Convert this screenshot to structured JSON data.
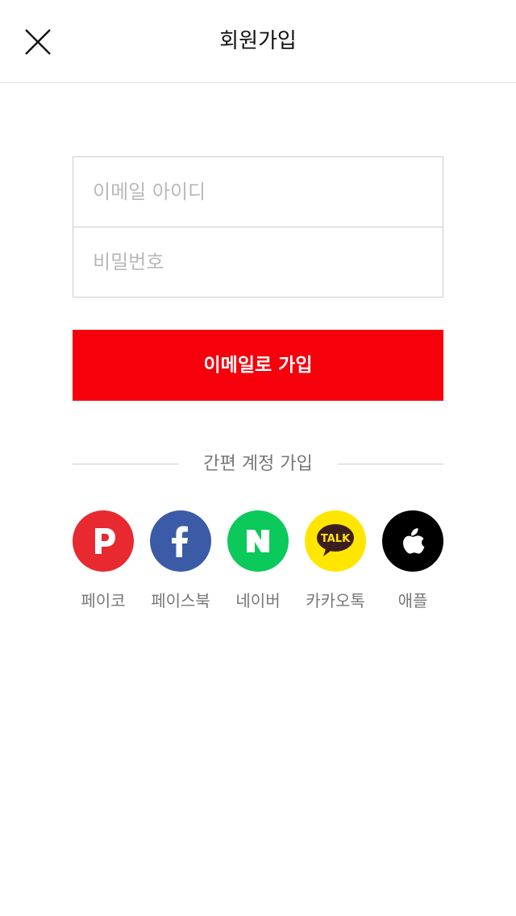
{
  "header": {
    "title": "회원가입",
    "close_icon": "close-icon"
  },
  "form": {
    "email_placeholder": "이메일 아이디",
    "email_value": "",
    "password_placeholder": "비밀번호",
    "password_value": ""
  },
  "signup_button": {
    "label": "이메일로 가입",
    "color": "#f5000b"
  },
  "social": {
    "title": "간편 계정 가입",
    "items": [
      {
        "label": "페이코",
        "icon": "payco-icon",
        "color": "#e8292f"
      },
      {
        "label": "페이스북",
        "icon": "facebook-icon",
        "color": "#3b5ba7"
      },
      {
        "label": "네이버",
        "icon": "naver-icon",
        "color": "#0bc95a"
      },
      {
        "label": "카카오톡",
        "icon": "kakaotalk-icon",
        "color": "#ffe600"
      },
      {
        "label": "애플",
        "icon": "apple-icon",
        "color": "#000000"
      }
    ]
  }
}
